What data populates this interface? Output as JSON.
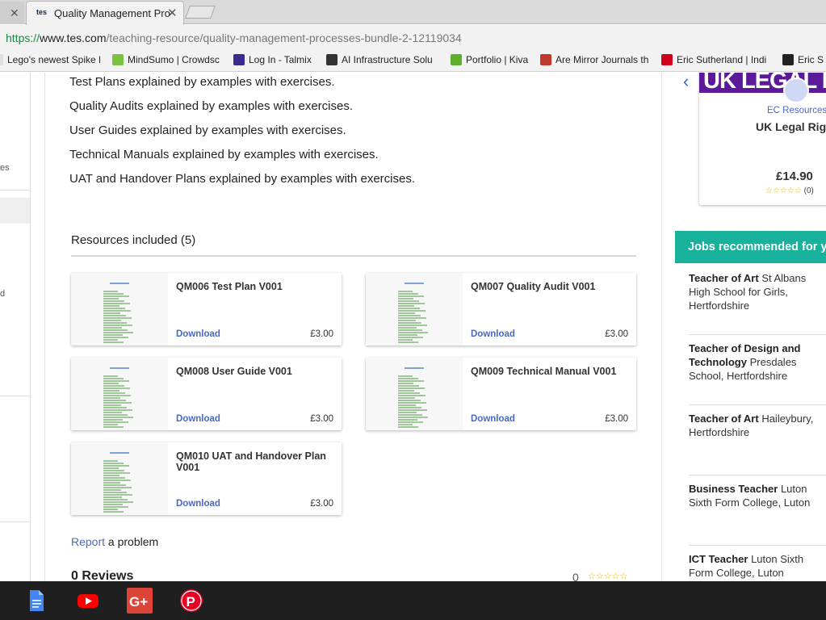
{
  "browser": {
    "tabs": [
      {
        "title": "",
        "close": "✕"
      },
      {
        "favicon": "tes",
        "title": "Quality Management Pro",
        "close": "✕"
      }
    ],
    "url": {
      "scheme": "https://",
      "host": "www.tes.com",
      "path": "/teaching-resource/quality-management-processes-bundle-2-12119034"
    },
    "bookmarks": [
      {
        "label": "Lego's newest Spike P",
        "icon_color": "#e0e0e0"
      },
      {
        "label": "MindSumo | Crowdsc",
        "icon_color": "#7cc242"
      },
      {
        "label": "Log In - Talmix",
        "icon_color": "#3b2a8f"
      },
      {
        "label": "AI Infrastructure Solu",
        "icon_color": "#333333"
      },
      {
        "label": "Portfolio | Kiva",
        "icon_color": "#5fae2e"
      },
      {
        "label": "Are Mirror Journals th",
        "icon_color": "#c0392b"
      },
      {
        "label": "Eric Sutherland | Indi",
        "icon_color": "#d0021b"
      },
      {
        "label": "Eric S",
        "icon_color": "#222222"
      }
    ]
  },
  "leftnav": {
    "fragments": [
      "es",
      "d"
    ]
  },
  "description_lines": [
    "Test Plans explained by examples with exercises.",
    "Quality Audits explained by examples with exercises.",
    "User Guides explained by examples with exercises.",
    "Technical Manuals explained by examples with exercises.",
    "UAT and Handover Plans explained by examples with exercises."
  ],
  "resources": {
    "title": "Resources included (5)",
    "items": [
      {
        "name": "QM006 Test Plan V001",
        "download": "Download",
        "price": "£3.00"
      },
      {
        "name": "QM007 Quality Audit V001",
        "download": "Download",
        "price": "£3.00"
      },
      {
        "name": "QM008 User Guide V001",
        "download": "Download",
        "price": "£3.00"
      },
      {
        "name": "QM009 Technical Manual V001",
        "download": "Download",
        "price": "£3.00"
      },
      {
        "name": "QM010 UAT and Handover Plan V001",
        "download": "Download",
        "price": "£3.00"
      }
    ]
  },
  "report": {
    "link": "Report",
    "text": " a problem"
  },
  "reviews": {
    "title": "0 Reviews",
    "count": "0",
    "stars": "☆☆☆☆☆"
  },
  "promo": {
    "banner_text": "UK LEGAL R",
    "author": "EC Resources",
    "name": "UK Legal Righ",
    "price": "£14.90",
    "stars": "☆☆☆☆☆",
    "rating_count": "(0)"
  },
  "jobs": {
    "heading": "Jobs recommended for y",
    "items": [
      {
        "role": "Teacher of Art",
        "place": "St Albans High School for Girls, Hertfordshire"
      },
      {
        "role": "Teacher of Design and Technology",
        "place": "Presdales School, Hertfordshire"
      },
      {
        "role": "Teacher of Art",
        "place": "Haileybury, Hertfordshire"
      },
      {
        "role": "Business Teacher",
        "place": "Luton Sixth Form College, Luton"
      },
      {
        "role": "ICT Teacher",
        "place": "Luton Sixth Form College, Luton"
      }
    ]
  },
  "taskbar": {
    "apps": [
      {
        "name": "google-docs",
        "color": "#4285f4"
      },
      {
        "name": "youtube",
        "color": "#ff0000"
      },
      {
        "name": "google-plus",
        "color": "#db4437"
      },
      {
        "name": "pinterest",
        "color": "#e60023"
      }
    ]
  }
}
